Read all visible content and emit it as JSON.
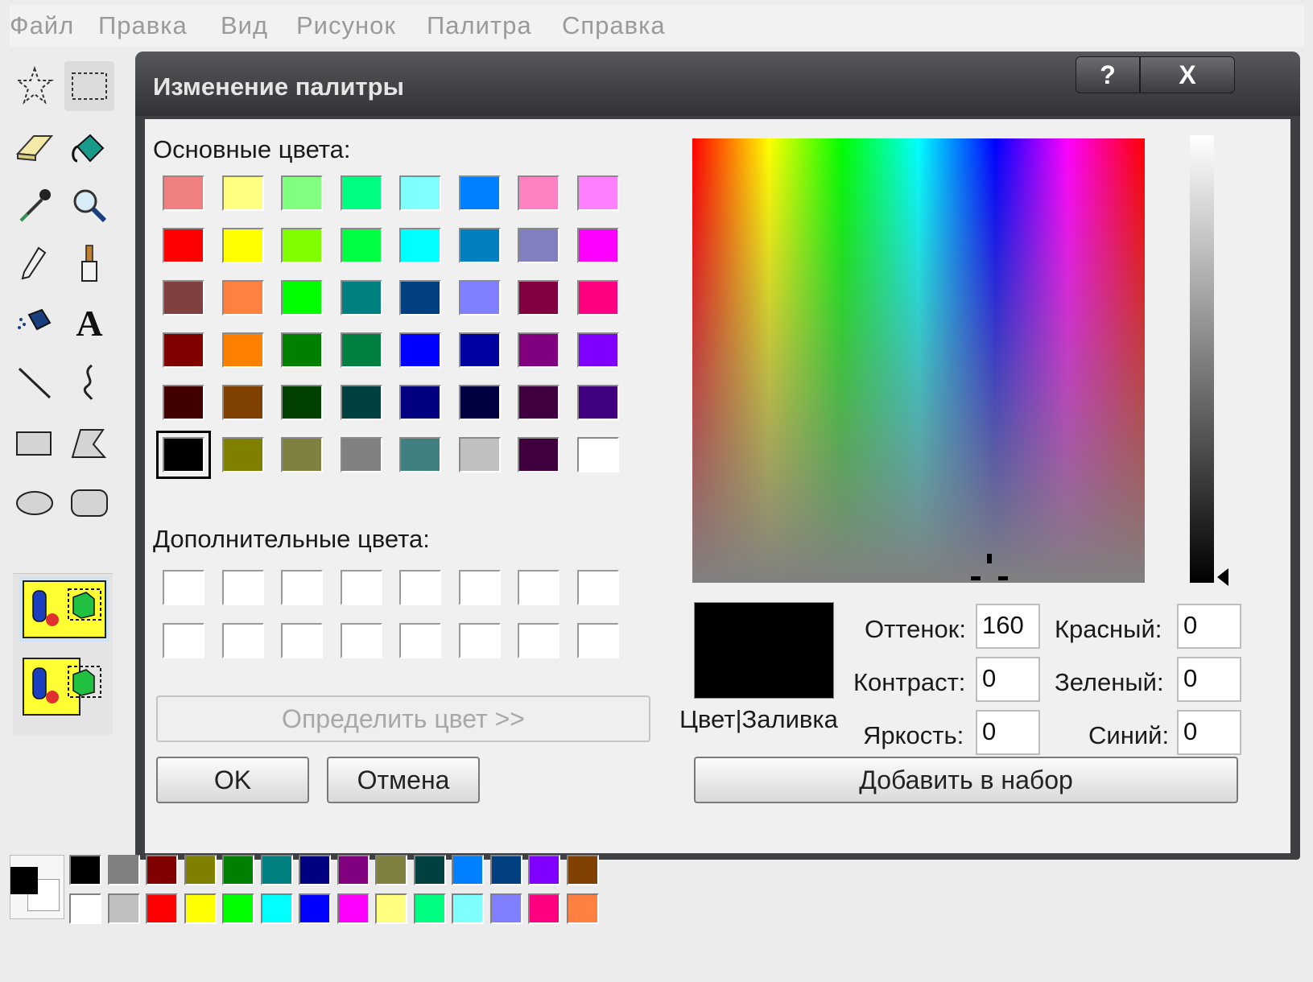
{
  "menu": {
    "items": [
      "Файл",
      "Правка",
      "Вид",
      "Рисунок",
      "Палитра",
      "Справка"
    ]
  },
  "toolbox": {
    "tools": [
      "free-select-icon",
      "rect-select-icon",
      "eraser-icon",
      "fill-icon",
      "eyedropper-icon",
      "magnifier-icon",
      "pencil-icon",
      "brush-icon",
      "airbrush-icon",
      "text-icon",
      "line-icon",
      "curve-icon",
      "rectangle-icon",
      "polygon-icon",
      "ellipse-icon",
      "rounded-rect-icon"
    ],
    "text_tool_glyph": "A"
  },
  "dialog": {
    "title": "Изменение палитры",
    "help_glyph": "?",
    "close_glyph": "X",
    "basic_label": "Основные цвета:",
    "custom_label": "Дополнительные цвета:",
    "basic_colors": [
      [
        "#f08080",
        "#ffff80",
        "#80ff80",
        "#00ff80",
        "#80ffff",
        "#0080ff",
        "#ff80c0",
        "#ff80ff"
      ],
      [
        "#ff0000",
        "#ffff00",
        "#80ff00",
        "#00ff40",
        "#00ffff",
        "#0080c0",
        "#8080c0",
        "#ff00ff"
      ],
      [
        "#804040",
        "#ff8040",
        "#00ff00",
        "#008080",
        "#004080",
        "#8080ff",
        "#800040",
        "#ff0080"
      ],
      [
        "#800000",
        "#ff8000",
        "#008000",
        "#008040",
        "#0000ff",
        "#0000a0",
        "#800080",
        "#8000ff"
      ],
      [
        "#400000",
        "#804000",
        "#004000",
        "#004040",
        "#000080",
        "#000040",
        "#400040",
        "#400080"
      ],
      [
        "#000000",
        "#808000",
        "#808040",
        "#808080",
        "#408080",
        "#c0c0c0",
        "#400040",
        "#ffffff"
      ]
    ],
    "selected_basic": [
      5,
      0
    ],
    "define_button": "Определить цвет >>",
    "ok_button": "OK",
    "cancel_button": "Отмена",
    "preview_color": "#000000",
    "preview_label": "Цвет|Заливка",
    "hue_label": "Оттенок:",
    "hue_value": "160",
    "sat_label": "Контраст:",
    "sat_value": "0",
    "lum_label": "Яркость:",
    "lum_value": "0",
    "red_label": "Красный:",
    "red_value": "0",
    "green_label": "Зеленый:",
    "green_value": "0",
    "blue_label": "Синий:",
    "blue_value": "0",
    "add_button": "Добавить в набор"
  },
  "palette": {
    "foreground": "#000000",
    "background": "#ffffff",
    "top_row": [
      "#000000",
      "#808080",
      "#800000",
      "#808000",
      "#008000",
      "#008080",
      "#000080",
      "#800080",
      "#808040",
      "#004040",
      "#0080ff",
      "#004080",
      "#8000ff",
      "#804000"
    ],
    "bottom_row": [
      "#ffffff",
      "#c0c0c0",
      "#ff0000",
      "#ffff00",
      "#00ff00",
      "#00ffff",
      "#0000ff",
      "#ff00ff",
      "#ffff80",
      "#00ff80",
      "#80ffff",
      "#8080ff",
      "#ff0080",
      "#ff8040"
    ]
  }
}
